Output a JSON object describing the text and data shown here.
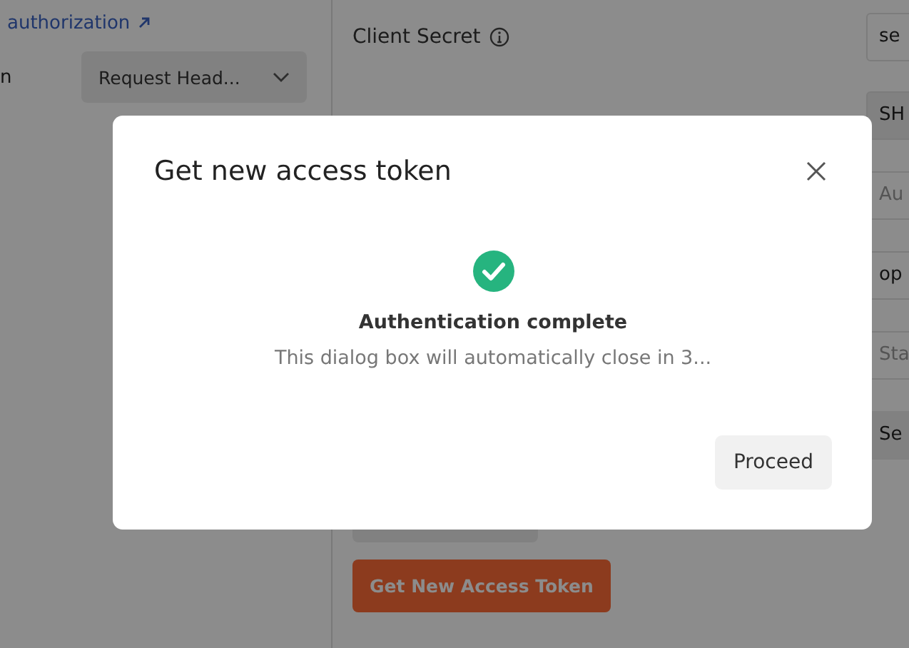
{
  "sidebar": {
    "link": "authorization",
    "auth_label": "n",
    "select": {
      "value": "Request Head..."
    }
  },
  "form": {
    "rows": [
      {
        "label": "Client Secret",
        "info": true,
        "field": {
          "kind": "value",
          "text": "se"
        }
      },
      {
        "field": {
          "kind": "select",
          "text": "SH"
        }
      },
      {
        "field": {
          "kind": "placeholder",
          "text": "Au"
        }
      },
      {
        "field": {
          "kind": "value",
          "text": "op"
        }
      },
      {
        "field": {
          "kind": "placeholder",
          "text": "Sta"
        }
      },
      {
        "field": {
          "kind": "button",
          "text": "Se"
        }
      }
    ],
    "get_token": "Get New Access Token"
  },
  "dialog": {
    "title": "Get new access token",
    "status": "Authentication complete",
    "message": "This dialog box will automatically close in 3...",
    "button": "Proceed"
  }
}
